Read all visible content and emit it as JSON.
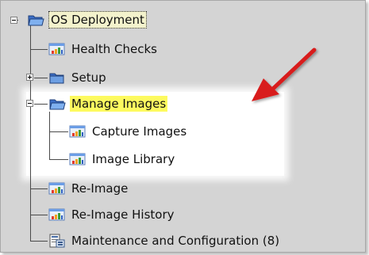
{
  "tree": {
    "root": {
      "label": "OS Deployment",
      "icon": "folder-icon",
      "expander": "minus"
    },
    "items": [
      {
        "label": "Health Checks",
        "icon": "report-icon"
      },
      {
        "label": "Setup",
        "icon": "folder-icon",
        "expander": "plus"
      },
      {
        "label": "Manage Images",
        "icon": "folder-icon",
        "expander": "minus"
      },
      {
        "label": "Capture Images",
        "icon": "report-icon"
      },
      {
        "label": "Image Library",
        "icon": "report-icon"
      },
      {
        "label": "Re-Image",
        "icon": "report-icon"
      },
      {
        "label": "Re-Image History",
        "icon": "report-icon"
      },
      {
        "label": "Maintenance and Configuration (8)",
        "icon": "tasks-icon"
      }
    ]
  },
  "annotation": {
    "icon": "red-arrow-icon",
    "color": "#d81e1e"
  },
  "colors": {
    "selection": "#fdfa5f",
    "folder": "#6b9de6",
    "panel": "#d4d4d4"
  }
}
